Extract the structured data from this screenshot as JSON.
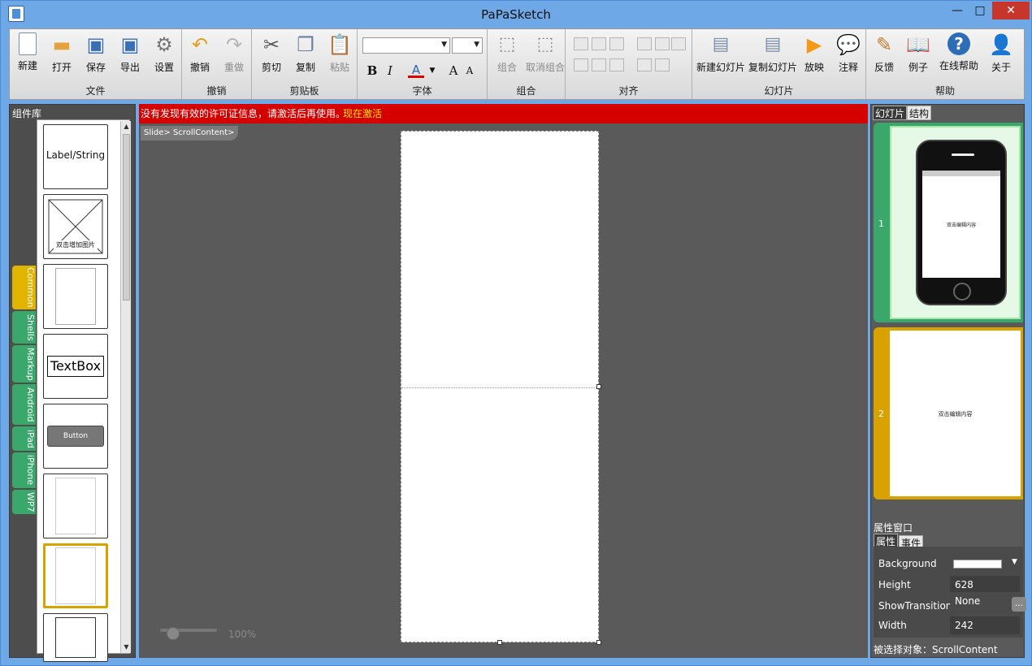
{
  "window": {
    "title": "PaPaSketch",
    "min": "—",
    "max": "□",
    "close": "✕"
  },
  "ribbon": {
    "groups": {
      "file": "文件",
      "undo": "撤销",
      "clipboard": "剪贴板",
      "font": "字体",
      "combine": "组合",
      "align": "对齐",
      "slides": "幻灯片",
      "help": "帮助"
    },
    "buttons": {
      "new": "新建",
      "open": "打开",
      "save": "保存",
      "export": "导出",
      "settings": "设置",
      "undo": "撤销",
      "redo": "重做",
      "cut": "剪切",
      "copy": "复制",
      "paste": "粘贴",
      "group": "组合",
      "ungroup": "取消组合",
      "new_slide": "新建幻灯片",
      "copy_slide": "复制幻灯片",
      "play": "放映",
      "note": "注释",
      "feedback": "反馈",
      "examples": "例子",
      "online_help": "在线帮助",
      "about": "关于"
    },
    "font": {
      "bold": "B",
      "italic": "I",
      "color": "A",
      "grow": "A",
      "shrink": "A"
    }
  },
  "left_panel": {
    "title": "组件库",
    "tabs": [
      "Common",
      "Shells",
      "Markup",
      "Android",
      "iPad",
      "iPhone",
      "WP7"
    ],
    "components": {
      "label": "Label/String",
      "image": "双击增加图片",
      "textbox": "TextBox",
      "button": "Button"
    }
  },
  "canvas": {
    "warning": "没有发现有效的许可证信息，请激活后再使用。",
    "activate": "现在激活",
    "breadcrumb": "Slide> ScrollContent>",
    "zoom": "100%"
  },
  "right_panel": {
    "tabs": {
      "slides": "幻灯片",
      "structure": "结构"
    },
    "slides": [
      {
        "num": "1",
        "content": "双击编辑内容"
      },
      {
        "num": "2",
        "content": "双击编辑内容"
      }
    ],
    "properties": {
      "title": "属性窗口",
      "tab_props": "属性",
      "tab_events": "事件",
      "rows": {
        "background_key": "Background",
        "height_key": "Height",
        "height_val": "628",
        "transition_key": "ShowTransition",
        "transition_val": "None",
        "width_key": "Width",
        "width_val": "242"
      },
      "more": "...",
      "selected": "被选择对象：ScrollContent"
    }
  },
  "colors": {
    "accent": "#6ea8e6",
    "warning_bg": "#d50000",
    "activate": "#ffe600",
    "selected_tab": "#e0b400",
    "tab_green": "#3aa86b"
  }
}
